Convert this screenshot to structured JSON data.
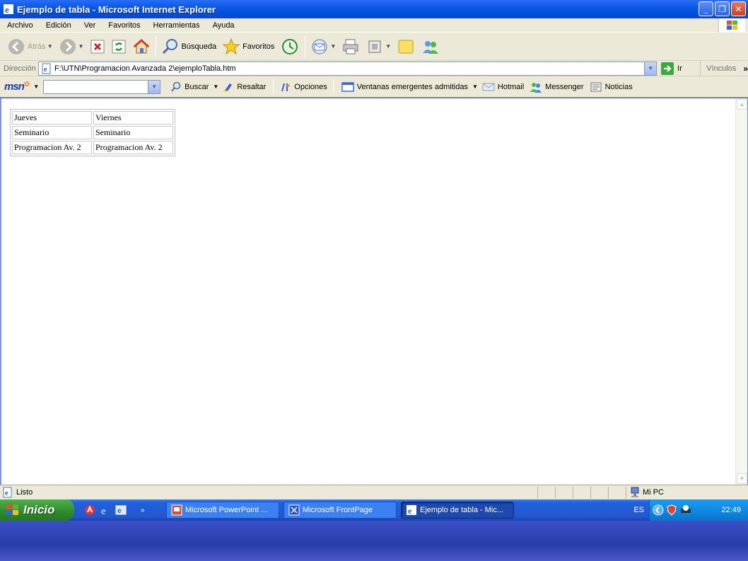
{
  "window": {
    "title": "Ejemplo de tabla - Microsoft Internet Explorer",
    "minimize": "_",
    "maximize": "❐",
    "close": "✕"
  },
  "menu": [
    "Archivo",
    "Edición",
    "Ver",
    "Favoritos",
    "Herramientas",
    "Ayuda"
  ],
  "toolbar": {
    "back": "Atrás",
    "search": "Búsqueda",
    "favorites": "Favoritos"
  },
  "address": {
    "label": "Dirección",
    "value": "F:\\UTN\\Programacion Avanzada 2\\ejemploTabla.htm",
    "go": "Ir",
    "links": "Vínculos"
  },
  "msn": {
    "logo": "msn",
    "search": "Buscar",
    "highlight": "Resaltar",
    "options": "Opciones",
    "popups": "Ventanas emergentes admitidas",
    "hotmail": "Hotmail",
    "messenger": "Messenger",
    "news": "Noticias"
  },
  "table": [
    [
      "Jueves",
      "Viernes"
    ],
    [
      "Seminario",
      "Seminario"
    ],
    [
      "Programacion Av. 2",
      "Programacion Av. 2"
    ]
  ],
  "status": {
    "text": "Listo",
    "zone": "Mi PC"
  },
  "taskbar": {
    "start": "Inicio",
    "tasks": [
      "Microsoft PowerPoint ...",
      "Microsoft FrontPage",
      "Ejemplo de tabla - Mic..."
    ],
    "lang": "ES",
    "clock": "22:49"
  }
}
